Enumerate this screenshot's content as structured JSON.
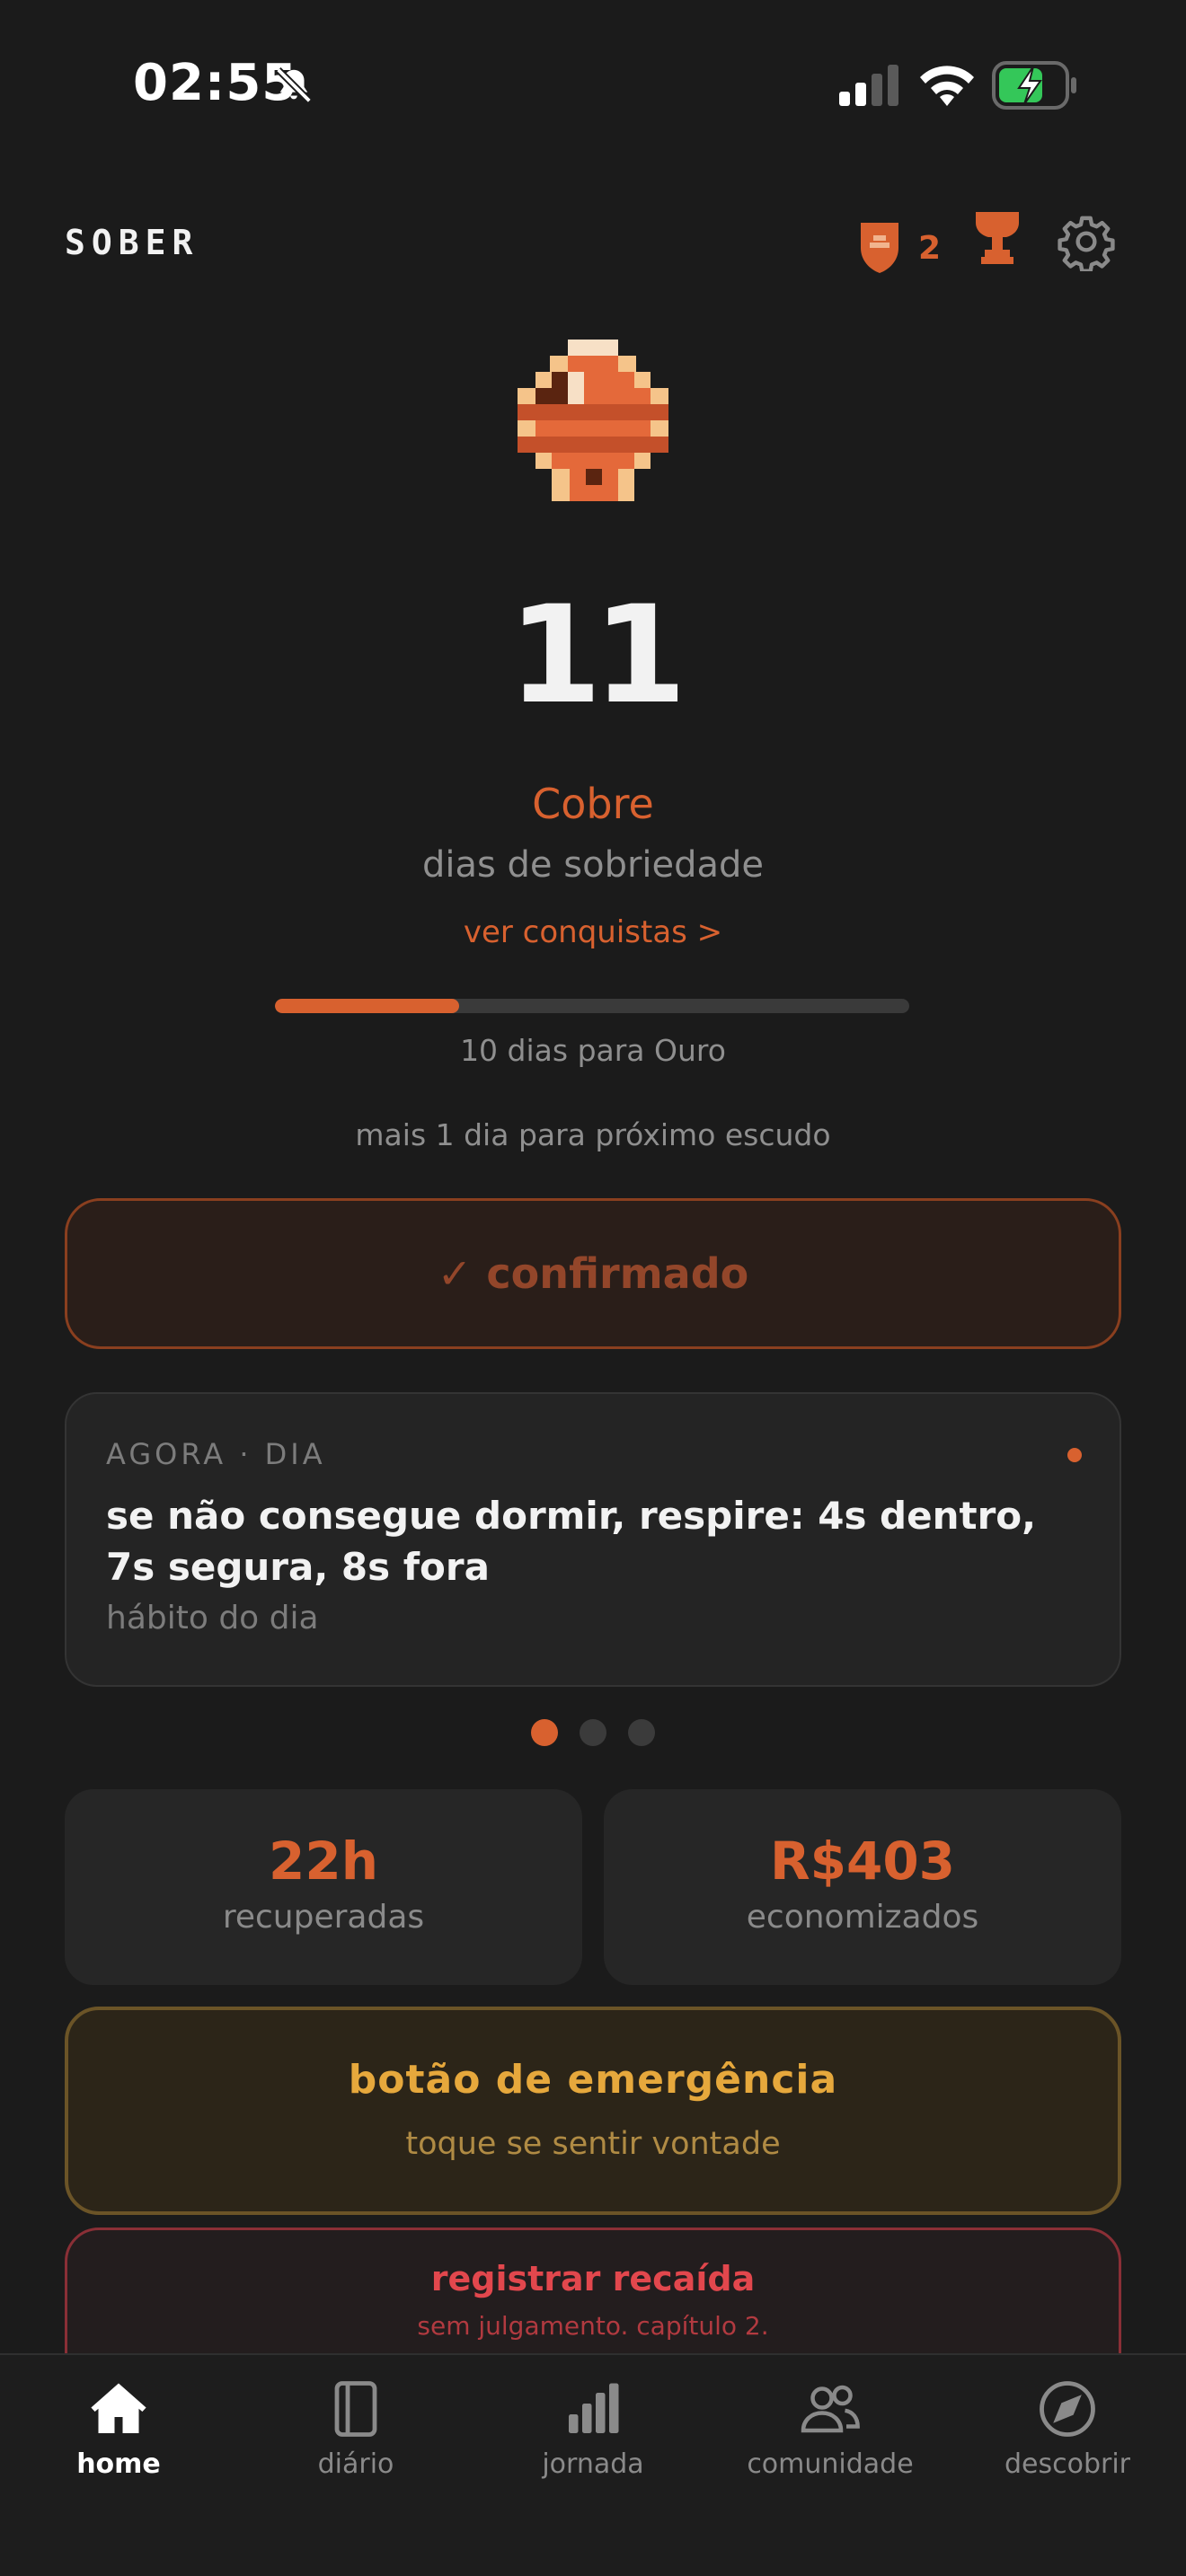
{
  "status_bar": {
    "time": "02:55",
    "icons": [
      "bell-muted-icon",
      "signal-icon",
      "wifi-icon",
      "battery-charging-icon"
    ]
  },
  "header": {
    "brand": "SOBER",
    "shield_count": "2",
    "icons": [
      "shield-icon",
      "trophy-icon",
      "gear-icon"
    ]
  },
  "hero": {
    "days": "11",
    "tier": "Cobre",
    "days_label": "dias de sobriedade",
    "achievements_link": "ver conquistas >",
    "progress_fraction": 0.29,
    "progress_label": "10 dias para Ouro",
    "next_shield": "mais 1 dia para próximo escudo"
  },
  "confirm": {
    "label": "✓ confirmado"
  },
  "tip_card": {
    "eyebrow": "AGORA · DIA",
    "text": "se não consegue dormir, respire: 4s dentro, 7s segura, 8s fora",
    "subtitle": "hábito do dia",
    "pages": 3,
    "active_page": 0
  },
  "stats": [
    {
      "value": "22h",
      "label": "recuperadas"
    },
    {
      "value": "R$403",
      "label": "economizados"
    }
  ],
  "emergency": {
    "title": "botão de emergência",
    "subtitle": "toque se sentir vontade"
  },
  "relapse": {
    "title": "registrar recaída",
    "subtitle": "sem julgamento. capítulo 2."
  },
  "tabs": [
    {
      "label": "home",
      "icon": "home-icon",
      "active": true
    },
    {
      "label": "diário",
      "icon": "journal-icon",
      "active": false
    },
    {
      "label": "jornada",
      "icon": "bar-chart-icon",
      "active": false
    },
    {
      "label": "comunidade",
      "icon": "people-icon",
      "active": false
    },
    {
      "label": "descobrir",
      "icon": "compass-icon",
      "active": false
    }
  ],
  "colors": {
    "accent": "#d8612f",
    "background": "#1b1b1b",
    "emergency": "#e6a83c",
    "danger": "#e2474d"
  }
}
